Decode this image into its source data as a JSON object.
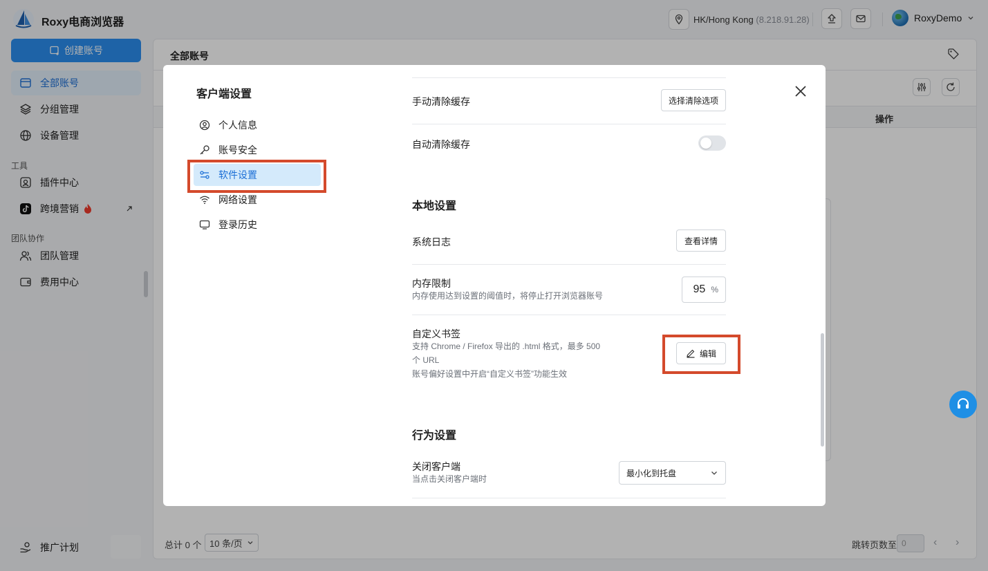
{
  "app": {
    "name": "Roxy电商浏览器"
  },
  "topbar": {
    "proxy_location": "HK/Hong Kong",
    "proxy_ip": "(8.218.91.28)",
    "user_name": "RoxyDemo"
  },
  "sidebar": {
    "create_button": "创建账号",
    "items": [
      {
        "label": "全部账号"
      },
      {
        "label": "分组管理"
      },
      {
        "label": "设备管理"
      }
    ],
    "tools_section": "工具",
    "tools": [
      {
        "label": "插件中心"
      },
      {
        "label": "跨境营销"
      }
    ],
    "team_section": "团队协作",
    "team": [
      {
        "label": "团队管理"
      },
      {
        "label": "费用中心"
      }
    ],
    "promo": "推广计划"
  },
  "main": {
    "title": "全部账号",
    "operation_column": "操作",
    "footer": {
      "total": "总计 0 个",
      "page_size": "10 条/页",
      "jump_label": "跳转页数至",
      "jump_value": "0"
    }
  },
  "modal": {
    "title": "客户端设置",
    "nav": [
      {
        "label": "个人信息"
      },
      {
        "label": "账号安全"
      },
      {
        "label": "软件设置"
      },
      {
        "label": "网络设置"
      },
      {
        "label": "登录历史"
      }
    ],
    "manual_cache": {
      "label": "手动清除缓存",
      "button": "选择清除选项"
    },
    "auto_cache": {
      "label": "自动清除缓存",
      "enabled": false
    },
    "local_section": "本地设置",
    "system_log": {
      "label": "系统日志",
      "button": "查看详情"
    },
    "memory_limit": {
      "label": "内存限制",
      "desc": "内存使用达到设置的阈值时，将停止打开浏览器账号",
      "value": "95",
      "unit": "%"
    },
    "bookmarks": {
      "label": "自定义书签",
      "desc_line1": "支持 Chrome / Firefox 导出的 .html 格式，最多 500",
      "desc_line2": "个 URL",
      "desc_line3": "账号偏好设置中开启“自定义书签”功能生效",
      "button": "编辑"
    },
    "behavior_section": "行为设置",
    "close_client": {
      "label": "关闭客户端",
      "desc": "当点击关闭客户端时",
      "selected": "最小化到托盘"
    }
  },
  "colors": {
    "primary": "#2b8ff0",
    "highlight": "#d44a2c",
    "active_nav_bg": "#d4eafb"
  }
}
